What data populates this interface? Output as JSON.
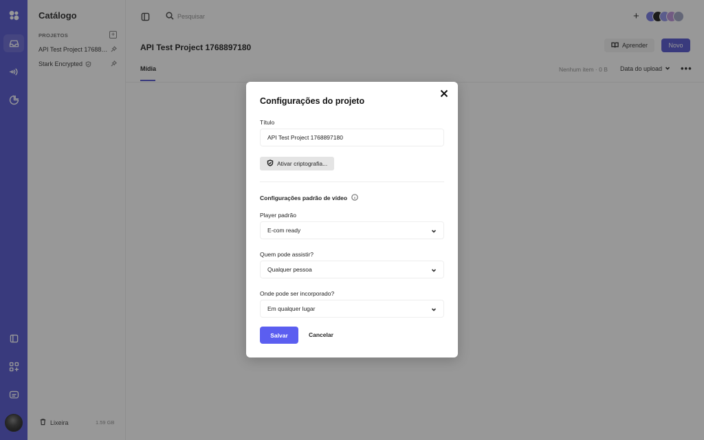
{
  "app": {
    "accent": "#4a4ccc",
    "primary_button": "#5b5ef0"
  },
  "rail": {
    "icons": [
      "logo-icon",
      "inbox-icon",
      "audio-icon",
      "chart-icon",
      "book-icon",
      "apps-icon",
      "chat-icon"
    ]
  },
  "sidebar": {
    "title": "Catálogo",
    "section_label": "PROJETOS",
    "projects": [
      {
        "label": "API Test Project 1768897180"
      },
      {
        "label": "Stark Encrypted"
      }
    ],
    "trash_label": "Lixeira",
    "trash_size": "1.59 GB"
  },
  "topbar": {
    "search_placeholder": "Pesquisar"
  },
  "header": {
    "project_title": "API Test Project 1768897180",
    "learn_label": "Aprender",
    "new_label": "Novo"
  },
  "tabs": {
    "media_label": "Mídia",
    "item_count": "Nenhum item · 0 B",
    "sort_label": "Data do upload"
  },
  "modal": {
    "title": "Configurações do projeto",
    "title_label": "Título",
    "title_value": "API Test Project 1768897180",
    "encrypt_label": "Ativar criptografia...",
    "video_section_label": "Configurações padrão de vídeo",
    "player_label": "Player padrão",
    "player_value": "E-com ready",
    "who_label": "Quem pode assistir?",
    "who_value": "Qualquer pessoa",
    "embed_label": "Onde pode ser incorporado?",
    "embed_value": "Em qualquer lugar",
    "save_label": "Salvar",
    "cancel_label": "Cancelar"
  }
}
